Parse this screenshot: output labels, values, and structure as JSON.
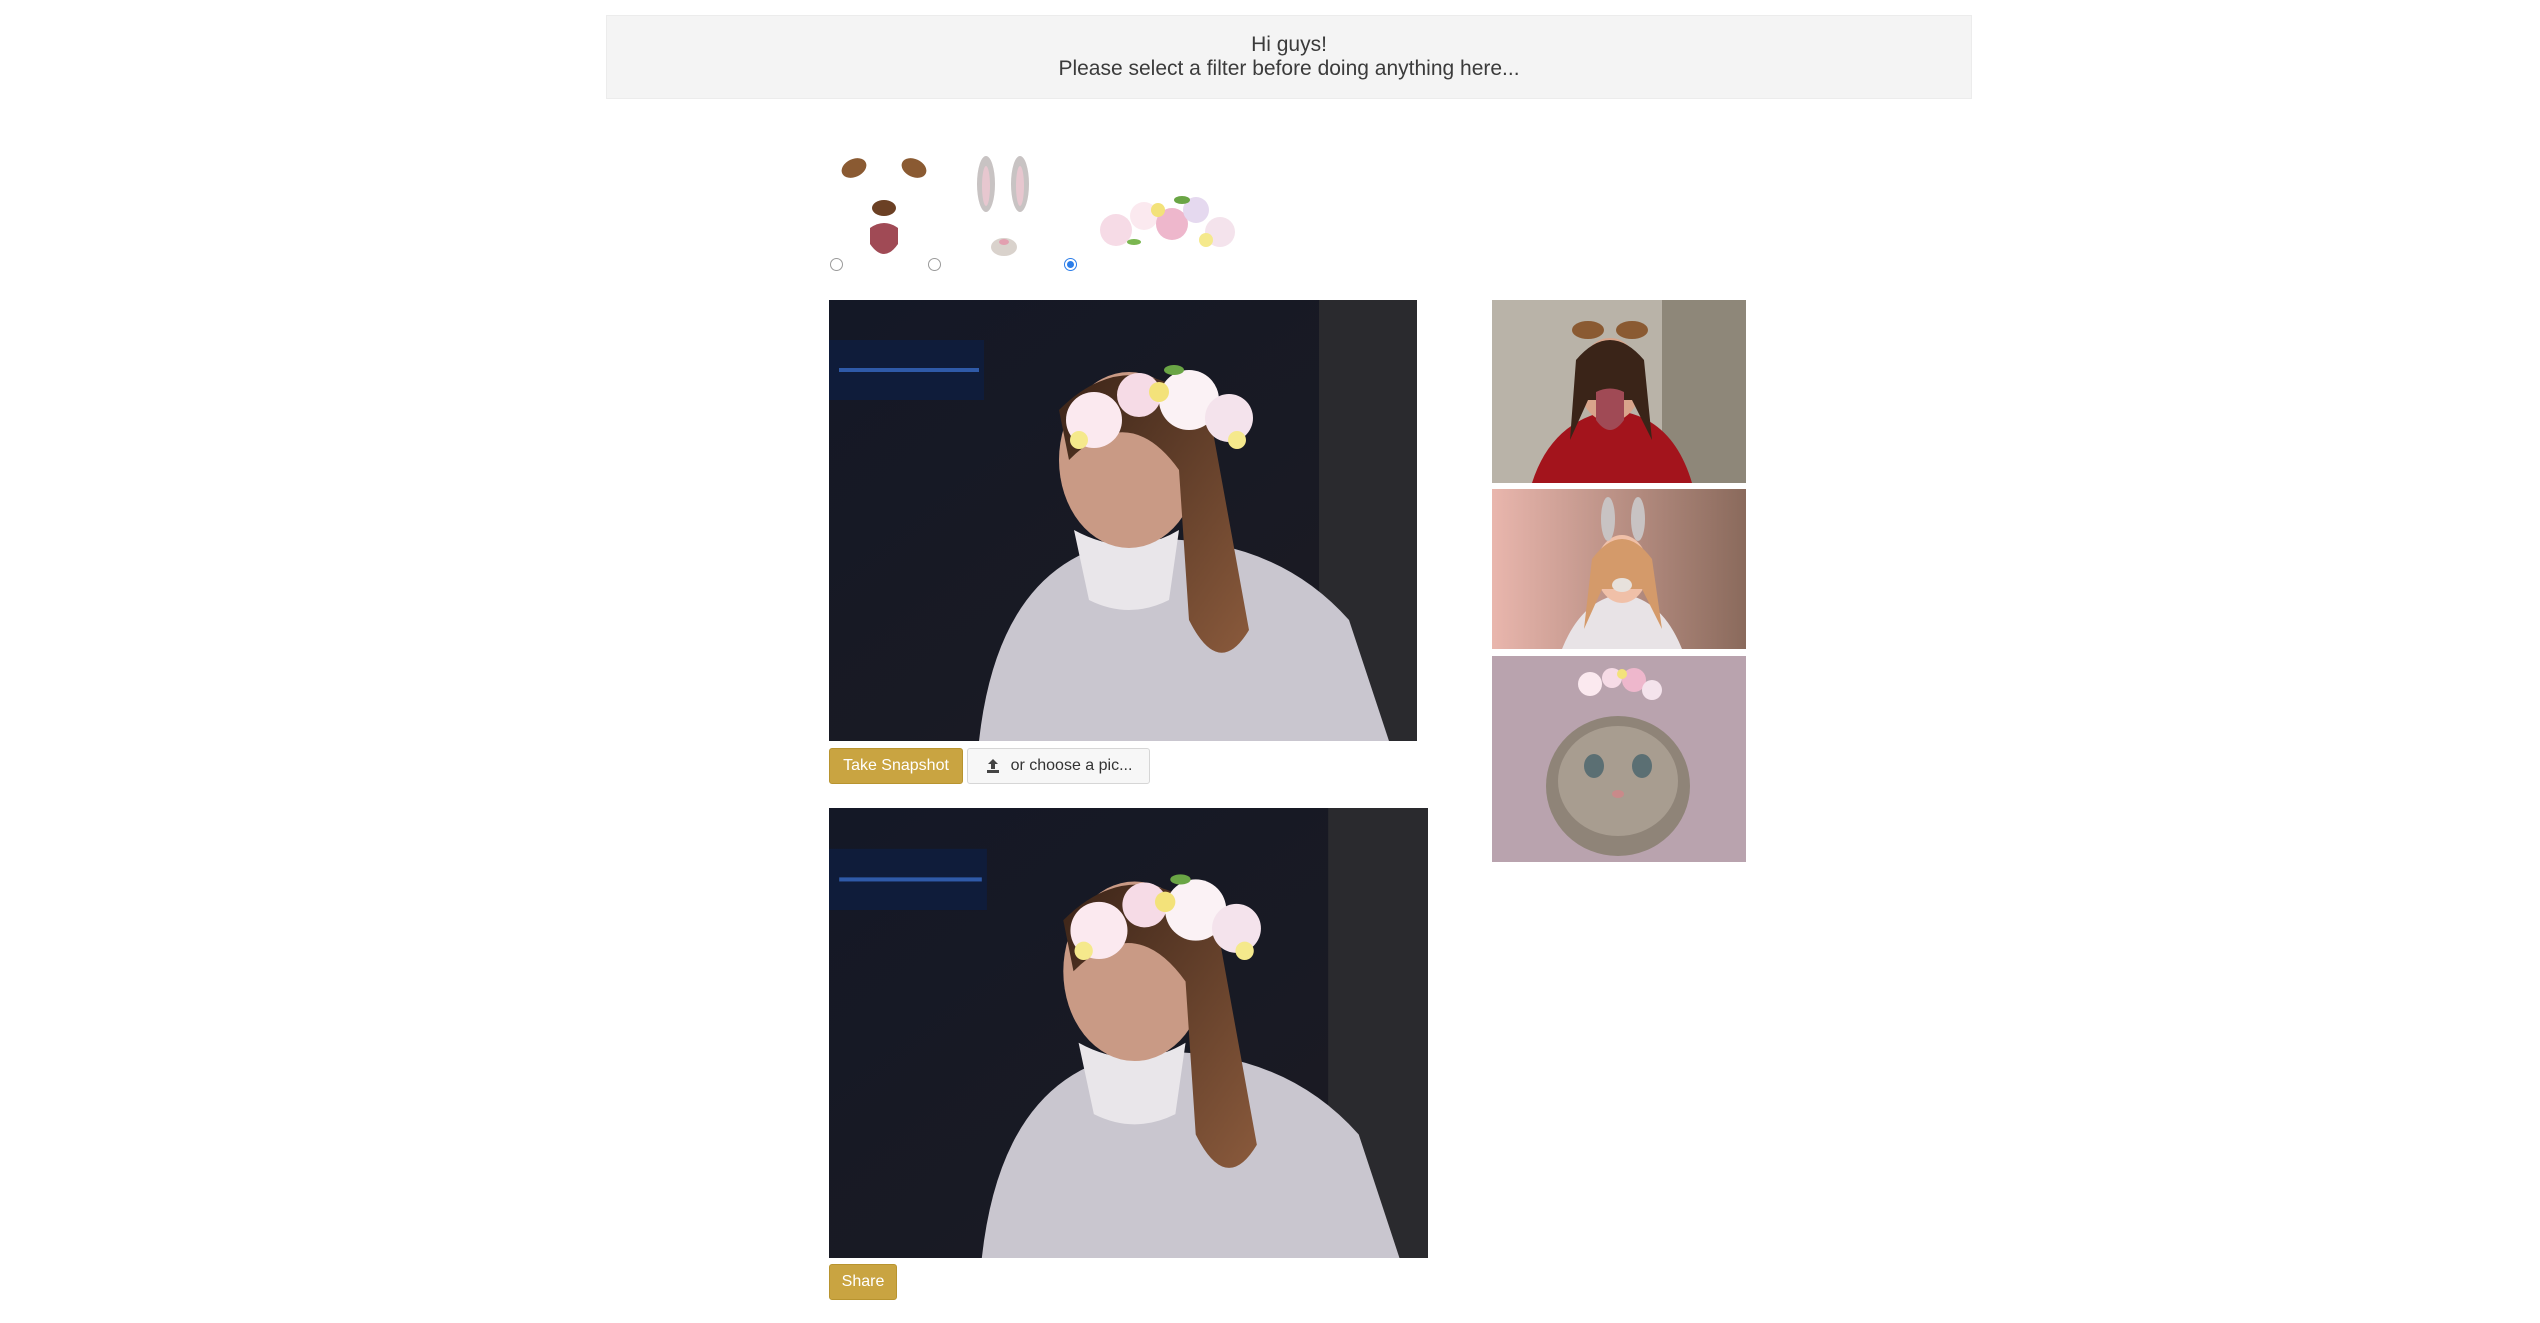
{
  "banner": {
    "line1": "Hi guys!",
    "line2": "Please select a filter before doing anything here..."
  },
  "filters": [
    {
      "name": "dog",
      "icon": "dog-filter-icon",
      "selected": false
    },
    {
      "name": "bunny",
      "icon": "bunny-filter-icon",
      "selected": false
    },
    {
      "name": "flower crown",
      "icon": "flower-crown-filter-icon",
      "selected": true
    }
  ],
  "camera": {
    "take_snapshot_label": "Take Snapshot",
    "choose_pic_label": "or choose a pic...",
    "upload_icon": "upload-icon"
  },
  "snapshot": {
    "share_label": "Share"
  },
  "gallery": [
    {
      "subject": "woman with dog filter",
      "filter": "dog"
    },
    {
      "subject": "girl with bunny filter",
      "filter": "bunny"
    },
    {
      "subject": "kitten with flower crown",
      "filter": "flower crown"
    }
  ],
  "colors": {
    "accent": "#c9a441",
    "radio_selected": "#2b7de9",
    "banner_bg": "#f4f4f4"
  }
}
